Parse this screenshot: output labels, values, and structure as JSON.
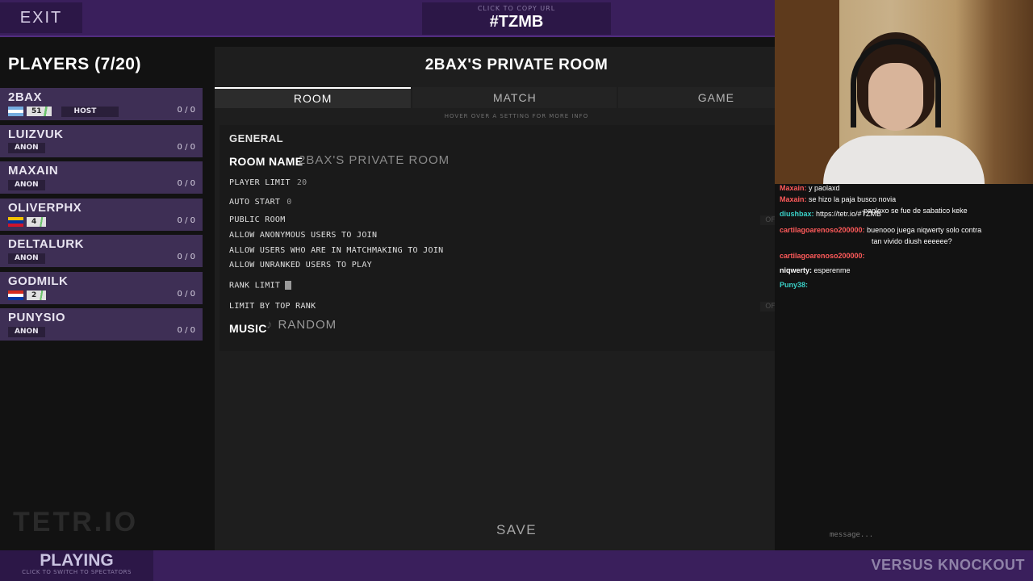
{
  "header": {
    "exit_label": "EXIT",
    "url_hint": "CLICK TO COPY URL",
    "room_code": "#TZMB"
  },
  "players": {
    "title": "PLAYERS (7/20)",
    "items": [
      {
        "name": "2BAX",
        "flag": "ar",
        "rank": "51",
        "tag": "HOST",
        "score": "0 / 0"
      },
      {
        "name": "LUIZVUK",
        "flag": "",
        "rank": "",
        "tag": "ANON",
        "score": "0 / 0"
      },
      {
        "name": "MAXAIN",
        "flag": "",
        "rank": "",
        "tag": "ANON",
        "score": "0 / 0"
      },
      {
        "name": "OLIVERPHX",
        "flag": "ve",
        "rank": "4",
        "tag": "",
        "score": "0 / 0"
      },
      {
        "name": "DELTALURK",
        "flag": "",
        "rank": "",
        "tag": "ANON",
        "score": "0 / 0"
      },
      {
        "name": "GODMILK",
        "flag": "py",
        "rank": "2",
        "tag": "",
        "score": "0 / 0"
      },
      {
        "name": "PUNYSIO",
        "flag": "",
        "rank": "",
        "tag": "ANON",
        "score": "0 / 0"
      }
    ]
  },
  "room": {
    "title": "2BAX'S PRIVATE ROOM",
    "tabs": [
      "ROOM",
      "MATCH",
      "GAME"
    ],
    "hover_hint": "HOVER OVER A SETTING FOR MORE INFO",
    "settings": {
      "section": "GENERAL",
      "room_name_label": "ROOM NAME",
      "room_name_value": "2BAX'S PRIVATE ROOM",
      "player_limit_label": "PLAYER LIMIT",
      "player_limit_value": "20",
      "auto_start_label": "AUTO START",
      "auto_start_value": "0",
      "public_room_label": "PUBLIC ROOM",
      "public_room_toggle": "OFF",
      "anon_label": "ALLOW ANONYMOUS USERS TO JOIN",
      "matchmaking_label": "ALLOW USERS WHO ARE IN MATCHMAKING TO JOIN",
      "unranked_label": "ALLOW UNRANKED USERS TO PLAY",
      "rank_limit_label": "RANK LIMIT",
      "limit_top_label": "LIMIT BY TOP RANK",
      "limit_top_toggle": "OFF",
      "music_label": "MUSIC",
      "music_value": "RANDOM"
    },
    "save_label": "SAVE"
  },
  "footer": {
    "playing_label": "PLAYING",
    "playing_hint": "CLICK TO SWITCH TO SPECTATORS",
    "mode": "VERSUS KNOCKOUT"
  },
  "chat": {
    "lines": [
      {
        "user": "Maxain:",
        "text": "y paolaxd",
        "color": "#ff5a5a"
      },
      {
        "user": "Maxain:",
        "text": "se hizo la paja busco novia",
        "color": "#ff5a5a"
      },
      {
        "user": "diushbax:",
        "text": "https://tetr.io/#TZMB",
        "color": "#3ad1c8"
      },
      {
        "user": "",
        "text": "paploxo se fue de sabatico keke",
        "color": "#ffffff"
      },
      {
        "user": "cartilagoarenoso200000:",
        "text": "buenooo juega niqwerty solo contra",
        "color": "#ff5a5a"
      },
      {
        "user": "",
        "text": "tan vivido diush eeeeee?",
        "color": "#ffffff"
      },
      {
        "user": "cartilagoarenoso200000:",
        "text": "",
        "color": "#ff5a5a"
      },
      {
        "user": "niqwerty:",
        "text": "esperenme",
        "color": "#ffffff"
      },
      {
        "user": "Puny38:",
        "text": "",
        "color": "#3ad1c8"
      }
    ],
    "input_placeholder": "message..."
  },
  "watermark": "TETR.IO"
}
